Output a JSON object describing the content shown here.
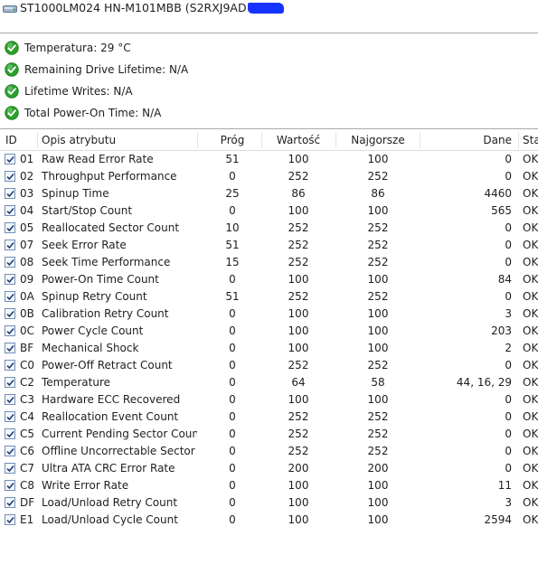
{
  "drive": {
    "title": "ST1000LM024 HN-M101MBB (S2RXJ9AD"
  },
  "status_items": [
    {
      "label": "Temperatura: 29 °C"
    },
    {
      "label": "Remaining Drive Lifetime: N/A"
    },
    {
      "label": "Lifetime Writes: N/A"
    },
    {
      "label": "Total Power-On Time: N/A"
    }
  ],
  "colors": {
    "ok_green": "#2aa02a",
    "redaction": "#1733ff",
    "separator": "#a9a9a9"
  },
  "table": {
    "headers": {
      "id": "ID",
      "desc": "Opis atrybutu",
      "prog": "Próg",
      "wart": "Wartość",
      "naj": "Najgorsze",
      "dane": "Dane",
      "stan": "Sta"
    },
    "rows": [
      {
        "id": "01",
        "desc": "Raw Read Error Rate",
        "prog": "51",
        "wart": "100",
        "naj": "100",
        "dane": "0",
        "stan": "OK"
      },
      {
        "id": "02",
        "desc": "Throughput Performance",
        "prog": "0",
        "wart": "252",
        "naj": "252",
        "dane": "0",
        "stan": "OK"
      },
      {
        "id": "03",
        "desc": "Spinup Time",
        "prog": "25",
        "wart": "86",
        "naj": "86",
        "dane": "4460",
        "stan": "OK"
      },
      {
        "id": "04",
        "desc": "Start/Stop Count",
        "prog": "0",
        "wart": "100",
        "naj": "100",
        "dane": "565",
        "stan": "OK"
      },
      {
        "id": "05",
        "desc": "Reallocated Sector Count",
        "prog": "10",
        "wart": "252",
        "naj": "252",
        "dane": "0",
        "stan": "OK"
      },
      {
        "id": "07",
        "desc": "Seek Error Rate",
        "prog": "51",
        "wart": "252",
        "naj": "252",
        "dane": "0",
        "stan": "OK"
      },
      {
        "id": "08",
        "desc": "Seek Time Performance",
        "prog": "15",
        "wart": "252",
        "naj": "252",
        "dane": "0",
        "stan": "OK"
      },
      {
        "id": "09",
        "desc": "Power-On Time Count",
        "prog": "0",
        "wart": "100",
        "naj": "100",
        "dane": "84",
        "stan": "OK"
      },
      {
        "id": "0A",
        "desc": "Spinup Retry Count",
        "prog": "51",
        "wart": "252",
        "naj": "252",
        "dane": "0",
        "stan": "OK"
      },
      {
        "id": "0B",
        "desc": "Calibration Retry Count",
        "prog": "0",
        "wart": "100",
        "naj": "100",
        "dane": "3",
        "stan": "OK"
      },
      {
        "id": "0C",
        "desc": "Power Cycle Count",
        "prog": "0",
        "wart": "100",
        "naj": "100",
        "dane": "203",
        "stan": "OK"
      },
      {
        "id": "BF",
        "desc": "Mechanical Shock",
        "prog": "0",
        "wart": "100",
        "naj": "100",
        "dane": "2",
        "stan": "OK"
      },
      {
        "id": "C0",
        "desc": "Power-Off Retract Count",
        "prog": "0",
        "wart": "252",
        "naj": "252",
        "dane": "0",
        "stan": "OK"
      },
      {
        "id": "C2",
        "desc": "Temperature",
        "prog": "0",
        "wart": "64",
        "naj": "58",
        "dane": "44, 16, 29",
        "stan": "OK"
      },
      {
        "id": "C3",
        "desc": "Hardware ECC Recovered",
        "prog": "0",
        "wart": "100",
        "naj": "100",
        "dane": "0",
        "stan": "OK"
      },
      {
        "id": "C4",
        "desc": "Reallocation Event Count",
        "prog": "0",
        "wart": "252",
        "naj": "252",
        "dane": "0",
        "stan": "OK"
      },
      {
        "id": "C5",
        "desc": "Current Pending Sector Count",
        "prog": "0",
        "wart": "252",
        "naj": "252",
        "dane": "0",
        "stan": "OK"
      },
      {
        "id": "C6",
        "desc": "Offline Uncorrectable Sector C...",
        "prog": "0",
        "wart": "252",
        "naj": "252",
        "dane": "0",
        "stan": "OK"
      },
      {
        "id": "C7",
        "desc": "Ultra ATA CRC Error Rate",
        "prog": "0",
        "wart": "200",
        "naj": "200",
        "dane": "0",
        "stan": "OK"
      },
      {
        "id": "C8",
        "desc": "Write Error Rate",
        "prog": "0",
        "wart": "100",
        "naj": "100",
        "dane": "11",
        "stan": "OK"
      },
      {
        "id": "DF",
        "desc": "Load/Unload Retry Count",
        "prog": "0",
        "wart": "100",
        "naj": "100",
        "dane": "3",
        "stan": "OK"
      },
      {
        "id": "E1",
        "desc": "Load/Unload Cycle Count",
        "prog": "0",
        "wart": "100",
        "naj": "100",
        "dane": "2594",
        "stan": "OK"
      }
    ]
  }
}
